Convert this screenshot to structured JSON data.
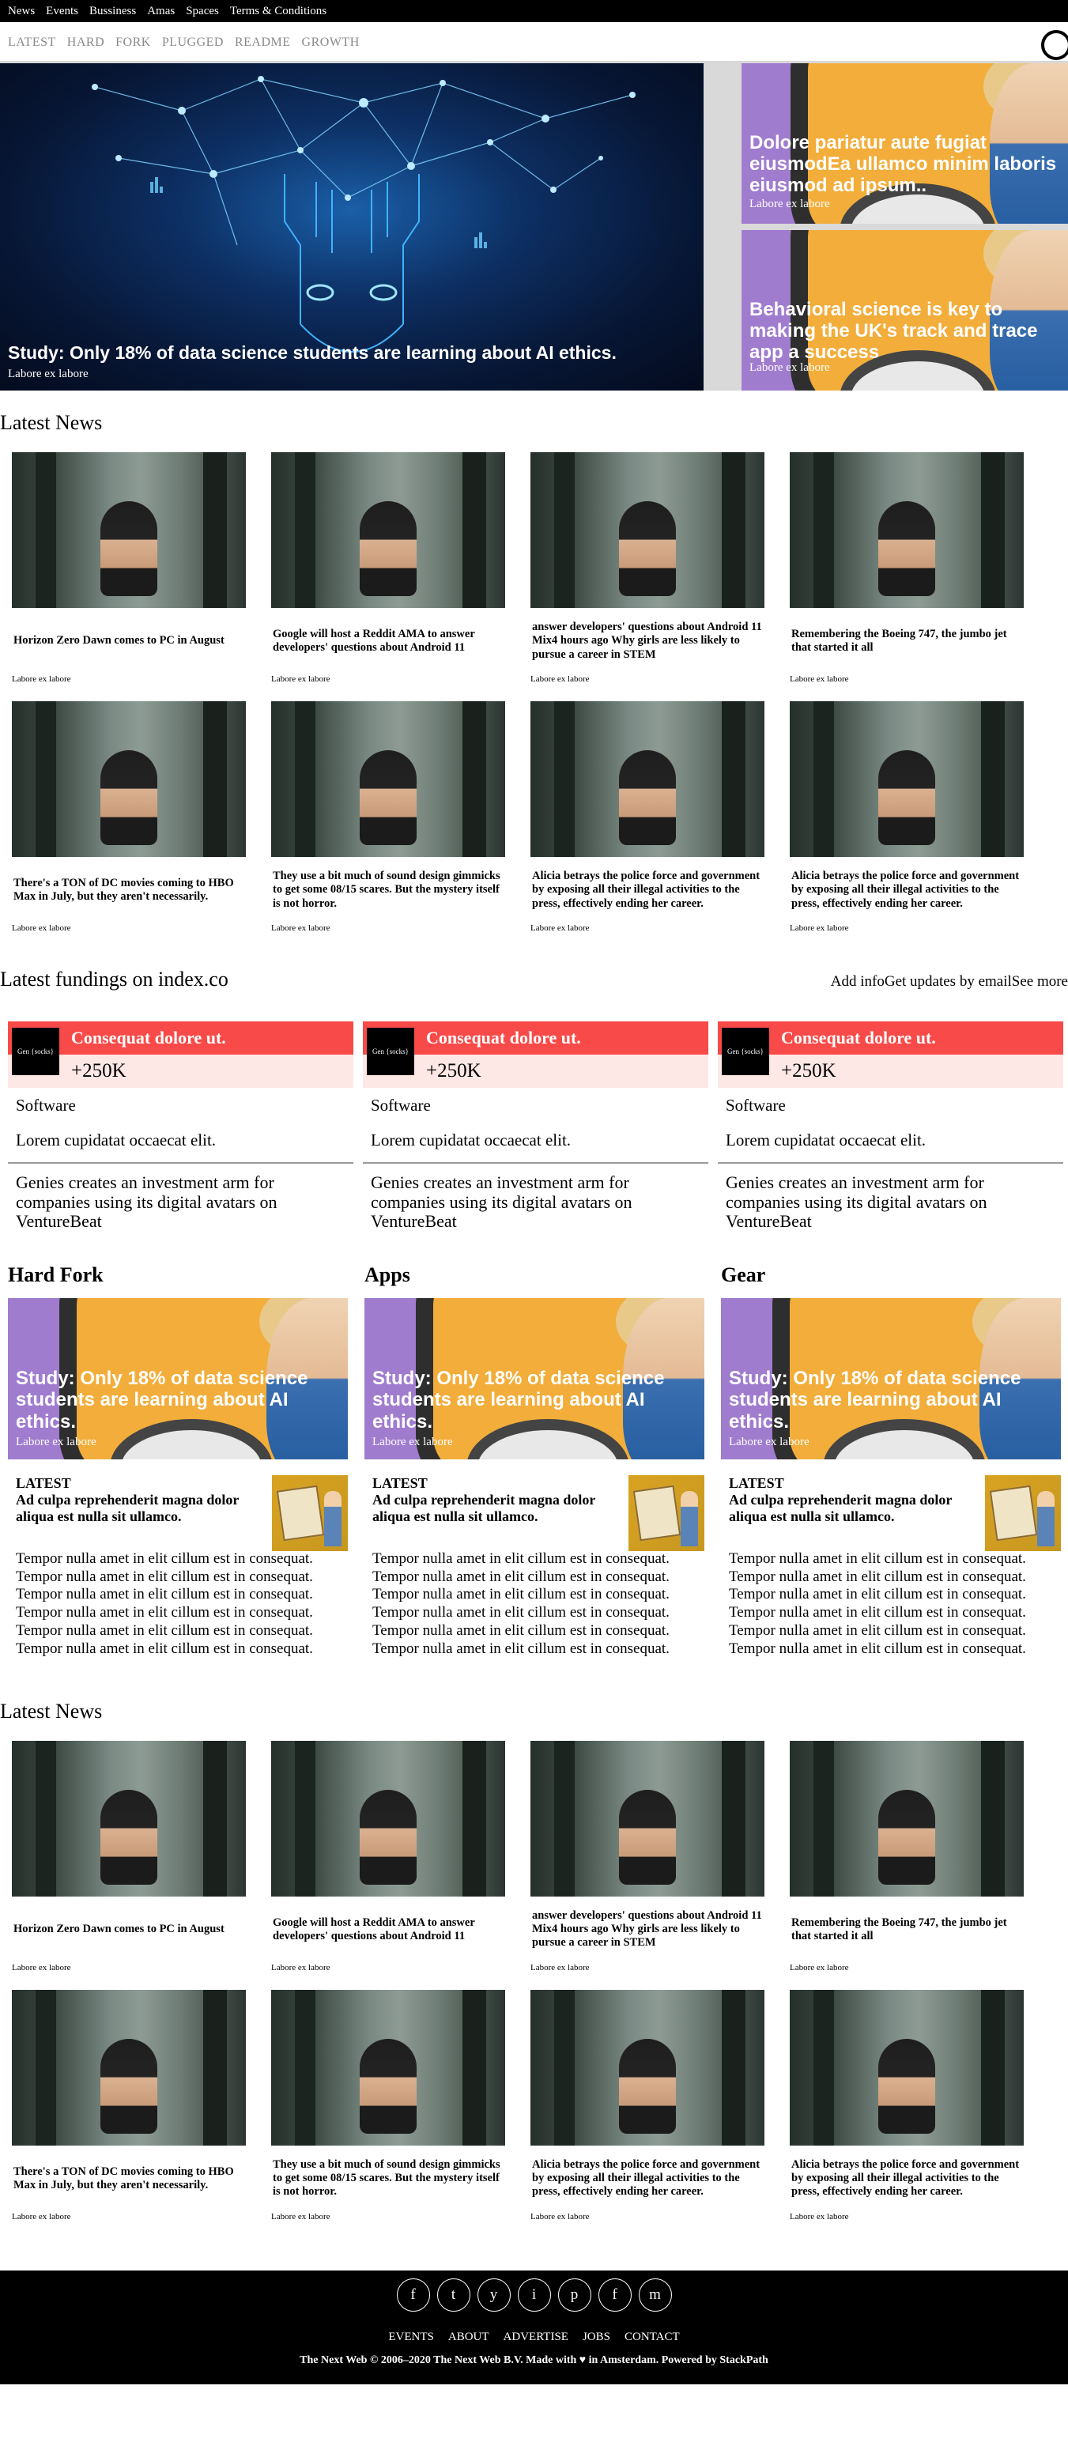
{
  "topbar": [
    "News",
    "Events",
    "Bussiness",
    "Amas",
    "Spaces",
    "Terms & Conditions"
  ],
  "sections": [
    "LATEST",
    "HARD",
    "FORK",
    "PLUGGED",
    "README",
    "GROWTH"
  ],
  "hero": {
    "main": {
      "title": "Study: Only 18% of data science students are learning about AI ethics.",
      "sub": "Labore ex labore"
    },
    "side": [
      {
        "title": "Dolore pariatur aute fugiat eiusmodEa ullamco minim laboris eiusmod ad ipsum..",
        "sub": "Labore ex labore"
      },
      {
        "title": "Behavioral science is key to making the UK's track and trace app a success",
        "sub": "Labore ex labore"
      }
    ]
  },
  "latest_heading": "Latest News",
  "news": [
    {
      "title": "Horizon Zero Dawn comes to PC in August",
      "sub": "Labore ex labore"
    },
    {
      "title": "Google will host a Reddit AMA to answer developers' questions about Android 11",
      "sub": "Labore ex labore"
    },
    {
      "title": "answer developers' questions about Android 11 Mix4 hours ago Why girls are less likely to pursue a career in STEM",
      "sub": "Labore ex labore"
    },
    {
      "title": "Remembering the Boeing 747, the jumbo jet that started it all",
      "sub": "Labore ex labore"
    },
    {
      "title": "There's a TON of DC movies coming to HBO Max in July, but they aren't necessarily.",
      "sub": "Labore ex labore"
    },
    {
      "title": "They use a bit much of sound design gimmicks to get some 08/15 scares. But the mystery itself is not horror.",
      "sub": "Labore ex labore"
    },
    {
      "title": "Alicia betrays the police force and government by exposing all their illegal activities to the press, effectively ending her career.",
      "sub": "Labore ex labore"
    },
    {
      "title": "Alicia betrays the police force and government by exposing all their illegal activities to the press, effectively ending her career.",
      "sub": "Labore ex labore"
    }
  ],
  "fundings": {
    "heading": "Latest fundings on index.co",
    "links": "Add infoGet updates by emailSee more",
    "items": [
      {
        "logo": "Gen {socks}",
        "name": "Consequat dolore ut.",
        "amount": "+250K",
        "category": "Software",
        "desc": "Lorem cupidatat occaecat elit.",
        "news": "Genies creates an investment arm for companies using its digital avatars on VentureBeat"
      },
      {
        "logo": "Gen {socks}",
        "name": "Consequat dolore ut.",
        "amount": "+250K",
        "category": "Software",
        "desc": "Lorem cupidatat occaecat elit.",
        "news": "Genies creates an investment arm for companies using its digital avatars on VentureBeat"
      },
      {
        "logo": "Gen {socks}",
        "name": "Consequat dolore ut.",
        "amount": "+250K",
        "category": "Software",
        "desc": "Lorem cupidatat occaecat elit.",
        "news": "Genies creates an investment arm for companies using its digital avatars on VentureBeat"
      }
    ]
  },
  "categories": [
    {
      "name": "Hard Fork",
      "hero_title": "Study: Only 18% of data science students are learning about AI ethics.",
      "hero_sub": "Labore ex labore",
      "latest_label": "LATEST",
      "latest_headline": "Ad culpa reprehenderit magna dolor aliqua est nulla sit ullamco.",
      "lines": [
        "Tempor nulla amet in elit cillum est in consequat.",
        "Tempor nulla amet in elit cillum est in consequat.",
        "Tempor nulla amet in elit cillum est in consequat.",
        "Tempor nulla amet in elit cillum est in consequat.",
        "Tempor nulla amet in elit cillum est in consequat.",
        "Tempor nulla amet in elit cillum est in consequat."
      ]
    },
    {
      "name": "Apps",
      "hero_title": "Study: Only 18% of data science students are learning about AI ethics.",
      "hero_sub": "Labore ex labore",
      "latest_label": "LATEST",
      "latest_headline": "Ad culpa reprehenderit magna dolor aliqua est nulla sit ullamco.",
      "lines": [
        "Tempor nulla amet in elit cillum est in consequat.",
        "Tempor nulla amet in elit cillum est in consequat.",
        "Tempor nulla amet in elit cillum est in consequat.",
        "Tempor nulla amet in elit cillum est in consequat.",
        "Tempor nulla amet in elit cillum est in consequat.",
        "Tempor nulla amet in elit cillum est in consequat."
      ]
    },
    {
      "name": "Gear",
      "hero_title": "Study: Only 18% of data science students are learning about AI ethics.",
      "hero_sub": "Labore ex labore",
      "latest_label": "LATEST",
      "latest_headline": "Ad culpa reprehenderit magna dolor aliqua est nulla sit ullamco.",
      "lines": [
        "Tempor nulla amet in elit cillum est in consequat.",
        "Tempor nulla amet in elit cillum est in consequat.",
        "Tempor nulla amet in elit cillum est in consequat.",
        "Tempor nulla amet in elit cillum est in consequat.",
        "Tempor nulla amet in elit cillum est in consequat.",
        "Tempor nulla amet in elit cillum est in consequat."
      ]
    }
  ],
  "footer": {
    "socials": [
      {
        "glyph": "f",
        "icon": "facebook-icon"
      },
      {
        "glyph": "t",
        "icon": "twitter-icon"
      },
      {
        "glyph": "y",
        "icon": "youtube-icon"
      },
      {
        "glyph": "i",
        "icon": "instagram-icon"
      },
      {
        "glyph": "p",
        "icon": "pinterest-icon"
      },
      {
        "glyph": "f",
        "icon": "flipboard-icon"
      },
      {
        "glyph": "m",
        "icon": "medium-icon"
      }
    ],
    "nav": [
      "EVENTS",
      "ABOUT",
      "ADVERTISE",
      "JOBS",
      "CONTACT"
    ],
    "copyright": "The Next Web © 2006–2020 The Next Web B.V. Made with ♥ in Amsterdam. Powered by StackPath"
  },
  "colors": {
    "funding_bar": "#f84a48",
    "funding_amount_bg": "#fde8e5",
    "topbar": "#000000",
    "footer": "#000000"
  }
}
